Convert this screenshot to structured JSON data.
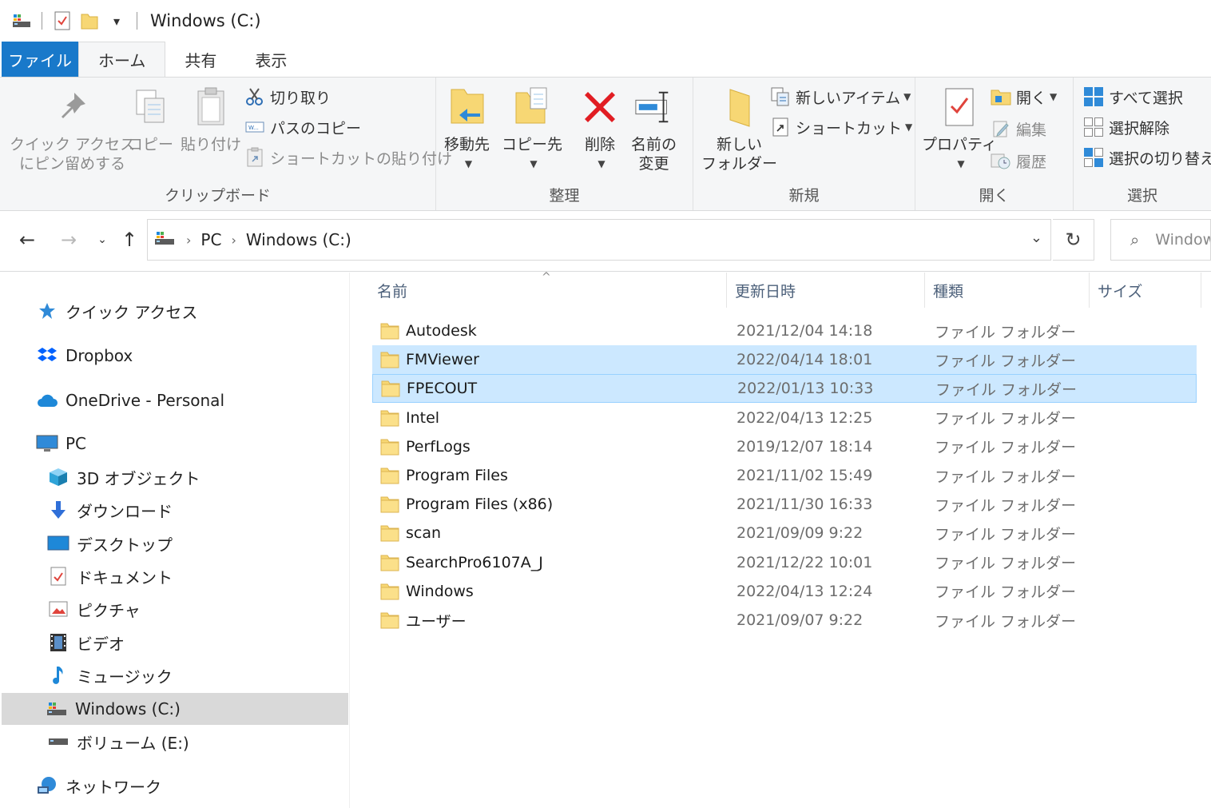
{
  "window": {
    "title": "Windows (C:)"
  },
  "tabs": [
    {
      "label": "ファイル"
    },
    {
      "label": "ホーム"
    },
    {
      "label": "共有"
    },
    {
      "label": "表示"
    }
  ],
  "ribbon": {
    "clipboard": {
      "label": "クリップボード",
      "pin_line1": "クイック アクセス",
      "pin_line2": "にピン留めする",
      "copy": "コピー",
      "paste": "貼り付け",
      "cut": "切り取り",
      "copy_path": "パスのコピー",
      "paste_shortcut": "ショートカットの貼り付け"
    },
    "organize": {
      "label": "整理",
      "move_to": "移動先",
      "copy_to": "コピー先",
      "delete": "削除",
      "rename_line1": "名前の",
      "rename_line2": "変更"
    },
    "new": {
      "label": "新規",
      "new_folder_line1": "新しい",
      "new_folder_line2": "フォルダー",
      "new_item": "新しいアイテム",
      "shortcut": "ショートカット"
    },
    "open": {
      "label": "開く",
      "properties": "プロパティ",
      "open": "開く",
      "edit": "編集",
      "history": "履歴"
    },
    "select": {
      "label": "選択",
      "select_all": "すべて選択",
      "select_none": "選択解除",
      "invert": "選択の切り替え"
    }
  },
  "address": {
    "crumbs": [
      "PC",
      "Windows (C:)"
    ],
    "search_placeholder": "Windows"
  },
  "navpane": {
    "quick_access": "クイック アクセス",
    "dropbox": "Dropbox",
    "onedrive": "OneDrive - Personal",
    "pc": "PC",
    "objects3d": "3D オブジェクト",
    "downloads": "ダウンロード",
    "desktop": "デスクトップ",
    "documents": "ドキュメント",
    "pictures": "ピクチャ",
    "videos": "ビデオ",
    "music": "ミュージック",
    "windows_c": "Windows (C:)",
    "volume_e": "ボリューム (E:)",
    "network": "ネットワーク"
  },
  "columns": {
    "name": "名前",
    "date": "更新日時",
    "type": "種類",
    "size": "サイズ"
  },
  "files": [
    {
      "name": "Autodesk",
      "date": "2021/12/04 14:18",
      "type": "ファイル フォルダー"
    },
    {
      "name": "FMViewer",
      "date": "2022/04/14 18:01",
      "type": "ファイル フォルダー"
    },
    {
      "name": "FPECOUT",
      "date": "2022/01/13 10:33",
      "type": "ファイル フォルダー"
    },
    {
      "name": "Intel",
      "date": "2022/04/13 12:25",
      "type": "ファイル フォルダー"
    },
    {
      "name": "PerfLogs",
      "date": "2019/12/07 18:14",
      "type": "ファイル フォルダー"
    },
    {
      "name": "Program Files",
      "date": "2021/11/02 15:49",
      "type": "ファイル フォルダー"
    },
    {
      "name": "Program Files (x86)",
      "date": "2021/11/30 16:33",
      "type": "ファイル フォルダー"
    },
    {
      "name": "scan",
      "date": "2021/09/09 9:22",
      "type": "ファイル フォルダー"
    },
    {
      "name": "SearchPro6107A_J",
      "date": "2021/12/22 10:01",
      "type": "ファイル フォルダー"
    },
    {
      "name": "Windows",
      "date": "2022/04/13 12:24",
      "type": "ファイル フォルダー"
    },
    {
      "name": "ユーザー",
      "date": "2021/09/07 9:22",
      "type": "ファイル フォルダー"
    }
  ],
  "colors": {
    "accent": "#1979ca",
    "selection": "#cce8ff",
    "selection_border": "#99d1ff",
    "folder": "#f7d774"
  }
}
